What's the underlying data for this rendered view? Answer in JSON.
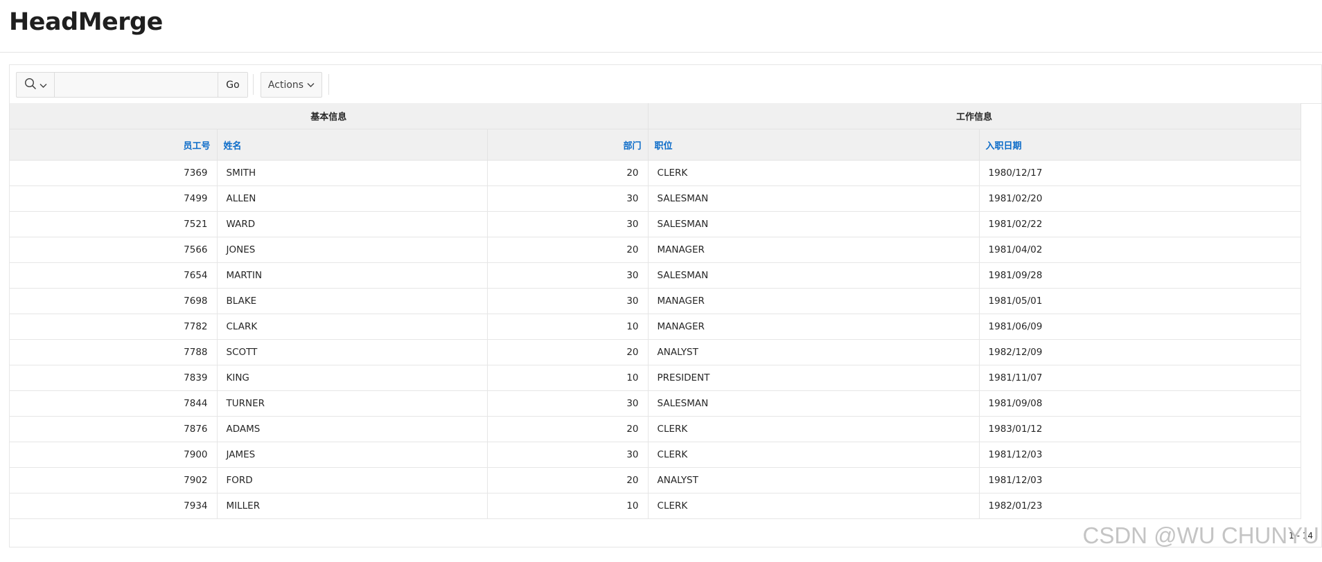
{
  "page": {
    "title": "HeadMerge"
  },
  "toolbar": {
    "search_value": "",
    "go_label": "Go",
    "actions_label": "Actions"
  },
  "table": {
    "group_headers": [
      "基本信息",
      "工作信息"
    ],
    "columns": [
      "员工号",
      "姓名",
      "部门",
      "职位",
      "入职日期"
    ],
    "rows": [
      [
        "7369",
        "SMITH",
        "20",
        "CLERK",
        "1980/12/17"
      ],
      [
        "7499",
        "ALLEN",
        "30",
        "SALESMAN",
        "1981/02/20"
      ],
      [
        "7521",
        "WARD",
        "30",
        "SALESMAN",
        "1981/02/22"
      ],
      [
        "7566",
        "JONES",
        "20",
        "MANAGER",
        "1981/04/02"
      ],
      [
        "7654",
        "MARTIN",
        "30",
        "SALESMAN",
        "1981/09/28"
      ],
      [
        "7698",
        "BLAKE",
        "30",
        "MANAGER",
        "1981/05/01"
      ],
      [
        "7782",
        "CLARK",
        "10",
        "MANAGER",
        "1981/06/09"
      ],
      [
        "7788",
        "SCOTT",
        "20",
        "ANALYST",
        "1982/12/09"
      ],
      [
        "7839",
        "KING",
        "10",
        "PRESIDENT",
        "1981/11/07"
      ],
      [
        "7844",
        "TURNER",
        "30",
        "SALESMAN",
        "1981/09/08"
      ],
      [
        "7876",
        "ADAMS",
        "20",
        "CLERK",
        "1983/01/12"
      ],
      [
        "7900",
        "JAMES",
        "30",
        "CLERK",
        "1981/12/03"
      ],
      [
        "7902",
        "FORD",
        "20",
        "ANALYST",
        "1981/12/03"
      ],
      [
        "7934",
        "MILLER",
        "10",
        "CLERK",
        "1982/01/23"
      ]
    ]
  },
  "pagination": {
    "text": "1 - 14"
  },
  "watermark": {
    "text": "CSDN @WU CHUNYU"
  },
  "icons": {
    "search": "search-icon",
    "chevron": "chevron-down-icon"
  },
  "colors": {
    "header_link": "#0b6bc8",
    "header_bg": "#f0f0f0"
  }
}
